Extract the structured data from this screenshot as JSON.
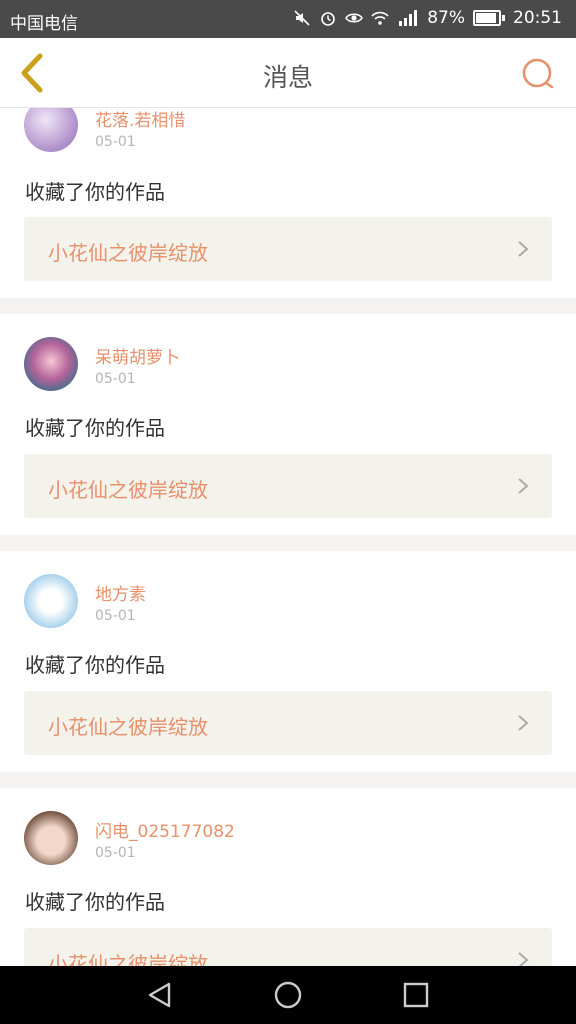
{
  "status_bar": {
    "carrier": "中国电信",
    "battery_percent": "87%",
    "time": "20:51",
    "icons": [
      "mute-icon",
      "alarm-icon",
      "eye-icon",
      "wifi-icon",
      "signal-icon",
      "battery-icon"
    ]
  },
  "header": {
    "title": "消息",
    "back_icon": "chevron-left-icon",
    "search_icon": "search-icon"
  },
  "colors": {
    "accent": "#e7906a",
    "back_arrow": "#c9a21a",
    "card_box": "#f3f3ec"
  },
  "messages": [
    {
      "username": "花落.若相惜",
      "date": "05-01",
      "action": "收藏了你的作品",
      "work_title": "小花仙之彼岸绽放"
    },
    {
      "username": "呆萌胡萝卜",
      "date": "05-01",
      "action": "收藏了你的作品",
      "work_title": "小花仙之彼岸绽放"
    },
    {
      "username": "地方素",
      "date": "05-01",
      "action": "收藏了你的作品",
      "work_title": "小花仙之彼岸绽放"
    },
    {
      "username": "闪电_025177082",
      "date": "05-01",
      "action": "收藏了你的作品",
      "work_title": "小花仙之彼岸绽放"
    }
  ],
  "nav_bar": {
    "buttons": [
      "back-triangle-icon",
      "home-circle-icon",
      "recents-square-icon"
    ]
  }
}
